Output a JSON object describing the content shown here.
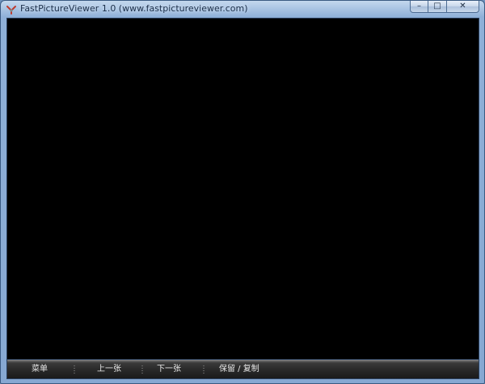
{
  "window": {
    "title": "FastPictureViewer 1.0 (www.fastpictureviewer.com)",
    "minimize_glyph": "–",
    "maximize_glyph": "□",
    "close_glyph": "✕"
  },
  "toolbar": {
    "menu_label": "菜单",
    "prev_label": "上一张",
    "next_label": "下一张",
    "keep_copy_label": "保留 / 复制"
  },
  "colors": {
    "viewport_bg": "#000000",
    "toolbar_text": "#e8e8e8",
    "frame_blue": "#86a8d2"
  }
}
